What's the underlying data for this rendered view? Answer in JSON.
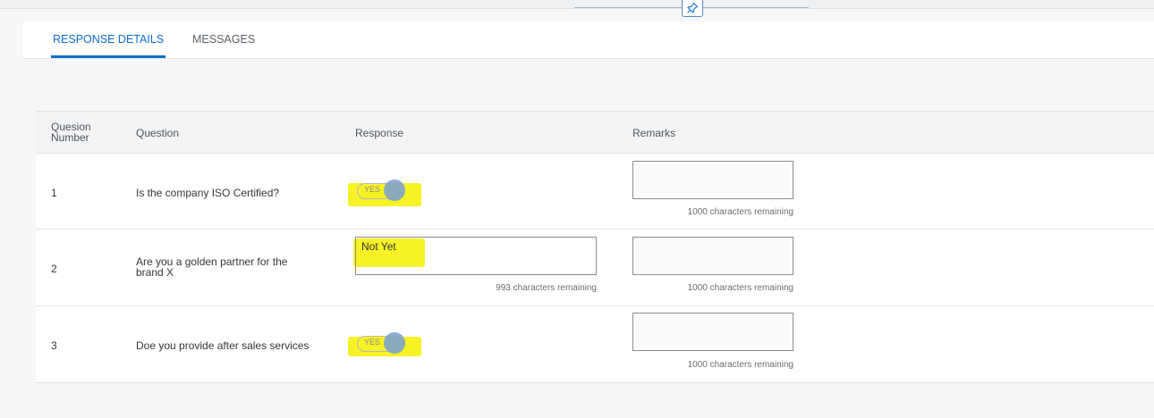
{
  "tabs": [
    {
      "label": "RESPONSE DETAILS",
      "active": true
    },
    {
      "label": "MESSAGES",
      "active": false
    }
  ],
  "table": {
    "headers": {
      "number_line1": "Quesion",
      "number_line2": "Number",
      "question": "Question",
      "response": "Response",
      "remarks": "Remarks"
    },
    "rows": [
      {
        "number": "1",
        "question": "Is the company ISO Certified?",
        "response_type": "switch",
        "switch_label": "YES",
        "remarks_value": "",
        "remarks_counter": "1000 characters remaining"
      },
      {
        "number": "2",
        "question": "Are you a golden partner for the brand X",
        "response_type": "text",
        "response_value": "Not Yet",
        "response_counter": "993 characters remaining",
        "remarks_value": "",
        "remarks_counter": "1000 characters remaining"
      },
      {
        "number": "3",
        "question": "Doe you provide after sales services",
        "response_type": "switch",
        "switch_label": "YES",
        "remarks_value": "",
        "remarks_counter": "1000 characters remaining"
      }
    ]
  },
  "icons": {
    "pin": "pin-icon"
  },
  "colors": {
    "accent": "#0a6ed1",
    "highlight": "#f4f000",
    "knob": "#7fa3cc"
  }
}
